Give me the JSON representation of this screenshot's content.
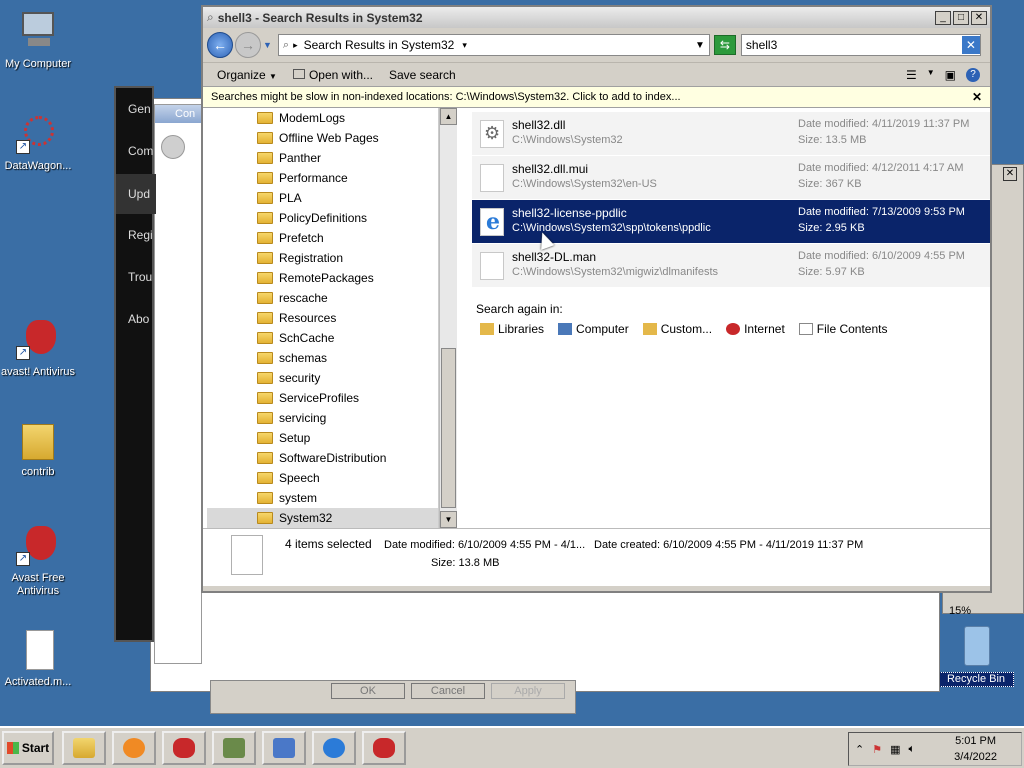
{
  "desktop_icons": [
    {
      "label": "My Computer"
    },
    {
      "label": "DataWagon..."
    },
    {
      "label": "avast! Antivirus"
    },
    {
      "label": "contrib"
    },
    {
      "label": "Avast Free Antivirus"
    },
    {
      "label": "Activated.m..."
    },
    {
      "label": "Recycle Bin"
    }
  ],
  "bg_panel": {
    "items": [
      "Gen",
      "Com",
      "Upd",
      "Regi",
      "Trou",
      "Abo"
    ],
    "small_title": "Con",
    "buttons": [
      "OK",
      "Cancel",
      "Apply"
    ],
    "percent": "15%"
  },
  "explorer": {
    "title": "shell3 - Search Results in System32",
    "address": "Search Results in System32",
    "search_value": "shell3",
    "commands": [
      "Organize",
      "Open with...",
      "Save search"
    ],
    "info_message": "Searches might be slow in non-indexed locations: C:\\Windows\\System32. Click to add to index...",
    "nav_items": [
      "ModemLogs",
      "Offline Web Pages",
      "Panther",
      "Performance",
      "PLA",
      "PolicyDefinitions",
      "Prefetch",
      "Registration",
      "RemotePackages",
      "rescache",
      "Resources",
      "SchCache",
      "schemas",
      "security",
      "ServiceProfiles",
      "servicing",
      "Setup",
      "SoftwareDistribution",
      "Speech",
      "system",
      "System32"
    ],
    "results": [
      {
        "name": "shell32.dll",
        "path": "C:\\Windows\\System32",
        "date": "Date modified: 4/11/2019 11:37 PM",
        "size": "Size: 13.5 MB",
        "icon": "gear-icon"
      },
      {
        "name": "shell32.dll.mui",
        "path": "C:\\Windows\\System32\\en-US",
        "date": "Date modified: 4/12/2011 4:17 AM",
        "size": "Size: 367 KB",
        "icon": "file-icon"
      },
      {
        "name": "shell32-license-ppdlic",
        "path": "C:\\Windows\\System32\\spp\\tokens\\ppdlic",
        "date": "Date modified: 7/13/2009 9:53 PM",
        "size": "Size: 2.95 KB",
        "icon": "ie-icon"
      },
      {
        "name": "shell32-DL.man",
        "path": "C:\\Windows\\System32\\migwiz\\dlmanifests",
        "date": "Date modified: 6/10/2009 4:55 PM",
        "size": "Size: 5.97 KB",
        "icon": "file-icon"
      }
    ],
    "search_again_label": "Search again in:",
    "search_again": [
      "Libraries",
      "Computer",
      "Custom...",
      "Internet",
      "File Contents"
    ],
    "details": {
      "selected": "4 items selected",
      "modified": "Date modified: 6/10/2009 4:55 PM - 4/1...",
      "created": "Date created: 6/10/2009 4:55 PM - 4/11/2019 11:37 PM",
      "size": "Size: 13.8 MB"
    }
  },
  "taskbar": {
    "start": "Start",
    "time": "5:01 PM",
    "date": "3/4/2022"
  }
}
